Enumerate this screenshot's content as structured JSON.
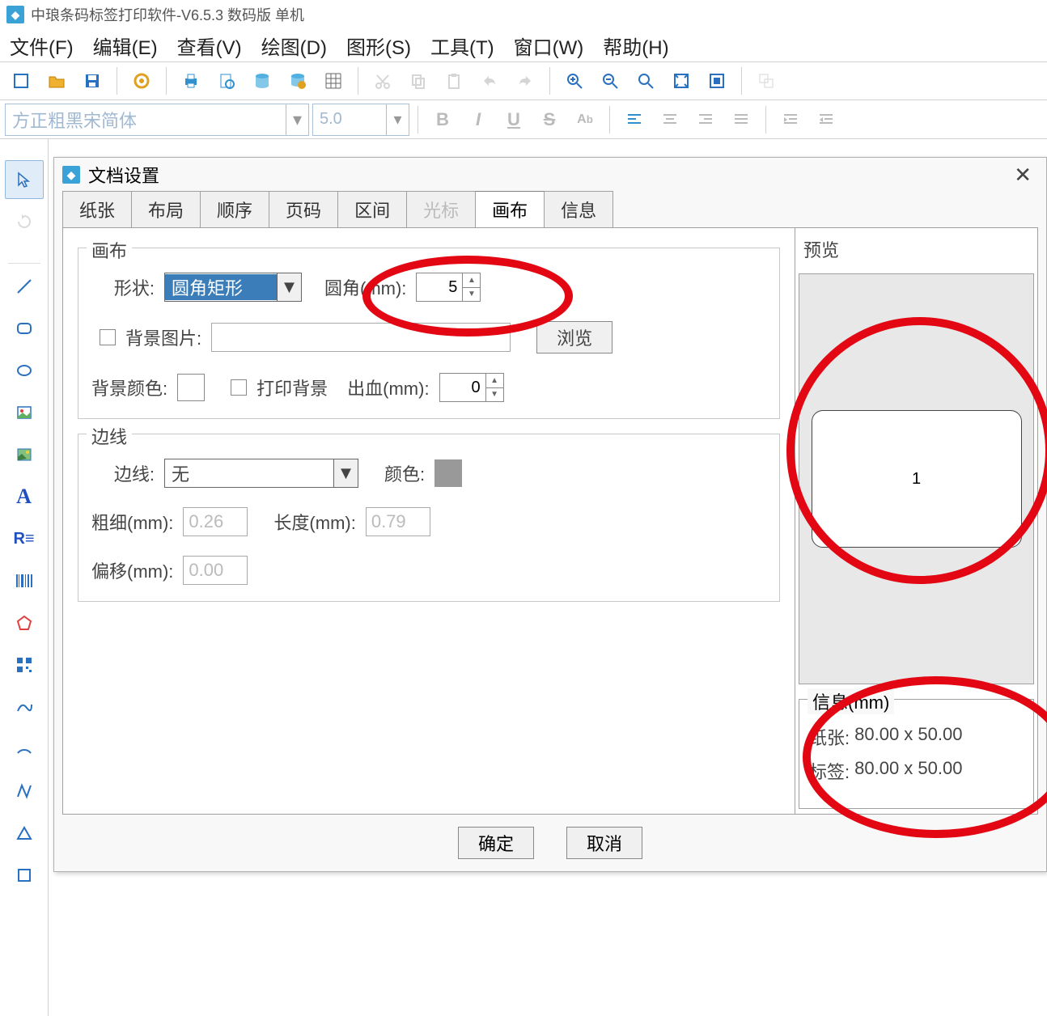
{
  "app": {
    "title": "中琅条码标签打印软件-V6.5.3 数码版 单机"
  },
  "menu": {
    "file": "文件(F)",
    "edit": "编辑(E)",
    "view": "查看(V)",
    "draw": "绘图(D)",
    "shape": "图形(S)",
    "tools": "工具(T)",
    "window": "窗口(W)",
    "help": "帮助(H)"
  },
  "toolbar2": {
    "font_name": "方正粗黑宋简体",
    "font_size": "5.0"
  },
  "dialog": {
    "title": "文档设置",
    "tabs": [
      "纸张",
      "布局",
      "顺序",
      "页码",
      "区间",
      "光标",
      "画布",
      "信息"
    ],
    "active_tab": "画布",
    "disabled_tab": "光标",
    "canvas": {
      "group_title": "画布",
      "shape_label": "形状:",
      "shape_value": "圆角矩形",
      "corner_label": "圆角(mm):",
      "corner_value": "5",
      "bgimg_label": "背景图片:",
      "browse": "浏览",
      "bgcolor_label": "背景颜色:",
      "printbg_label": "打印背景",
      "bleed_label": "出血(mm):",
      "bleed_value": "0"
    },
    "border": {
      "group_title": "边线",
      "border_label": "边线:",
      "border_value": "无",
      "color_label": "颜色:",
      "thickness_label": "粗细(mm):",
      "thickness_value": "0.26",
      "length_label": "长度(mm):",
      "length_value": "0.79",
      "offset_label": "偏移(mm):",
      "offset_value": "0.00"
    },
    "preview": {
      "title": "预览",
      "label_number": "1"
    },
    "info": {
      "title": "信息(mm)",
      "paper_label": "纸张:",
      "paper_value": "80.00 x 50.00",
      "label_label": "标签:",
      "label_value": "80.00 x 50.00"
    },
    "ok": "确定",
    "cancel": "取消"
  }
}
